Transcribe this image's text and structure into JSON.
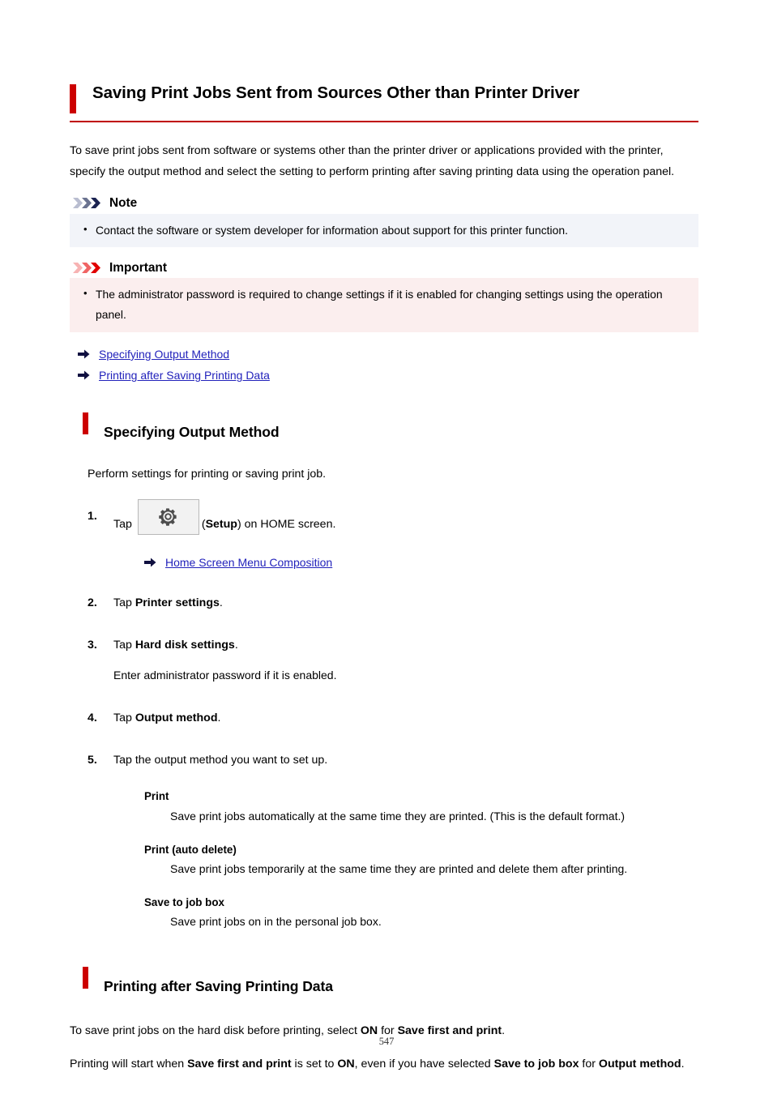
{
  "document": {
    "title": "Saving Print Jobs Sent from Sources Other than Printer Driver",
    "page_number": "547"
  },
  "intro": {
    "paragraph": "To save print jobs sent from software or systems other than the printer driver or applications provided with the printer, specify the output method and select the setting to perform printing after saving printing data using the operation panel."
  },
  "note": {
    "label": "Note",
    "icon": "triple-chevron-right-icon",
    "items": [
      "Contact the software or system developer for information about support for this printer function."
    ]
  },
  "important": {
    "label": "Important",
    "icon": "triple-chevron-right-icon",
    "items": [
      "The administrator password is required to change settings if it is enabled for changing settings using the operation panel."
    ]
  },
  "toc_links": [
    {
      "label": "Specifying Output Method",
      "icon": "arrow-right-icon"
    },
    {
      "label": "Printing after Saving Printing Data",
      "icon": "arrow-right-icon"
    }
  ],
  "section_output_method": {
    "heading": "Specifying Output Method",
    "lead": "Perform settings for printing or saving print job.",
    "steps": {
      "step1": {
        "prefix": "Tap",
        "icon": "gear-icon",
        "suffix_open": "(",
        "bold_word": "Setup",
        "suffix_close": ") on HOME screen.",
        "link": {
          "label": "Home Screen Menu Composition",
          "icon": "arrow-right-icon"
        }
      },
      "step2": {
        "prefix": "Tap ",
        "bold": "Printer settings",
        "suffix": "."
      },
      "step3": {
        "prefix": "Tap ",
        "bold": "Hard disk settings",
        "suffix": ".",
        "note": "Enter administrator password if it is enabled."
      },
      "step4": {
        "prefix": "Tap ",
        "bold": "Output method",
        "suffix": "."
      },
      "step5": {
        "text": "Tap the output method you want to set up."
      }
    },
    "definitions": [
      {
        "term": "Print",
        "description": "Save print jobs automatically at the same time they are printed. (This is the default format.)"
      },
      {
        "term": "Print (auto delete)",
        "description": "Save print jobs temporarily at the same time they are printed and delete them after printing."
      },
      {
        "term": "Save to job box",
        "description": "Save print jobs on in the personal job box."
      }
    ]
  },
  "section_printing_after_saving": {
    "heading": "Printing after Saving Printing Data",
    "para1": {
      "a": "To save print jobs on the hard disk before printing, select ",
      "b1": "ON",
      "b": " for ",
      "b2": "Save first and print",
      "c": "."
    },
    "para2": {
      "a": "Printing will start when ",
      "b1": "Save first and print",
      "b": " is set to ",
      "b2": "ON",
      "c": ", even if you have selected ",
      "b3": "Save to job box",
      "d": " for ",
      "b4": "Output method",
      "e": "."
    }
  },
  "colors": {
    "accent_red": "#cc0000",
    "link_blue": "#2222bb",
    "note_bg": "#f2f4f9",
    "important_bg": "#fbeeee"
  }
}
